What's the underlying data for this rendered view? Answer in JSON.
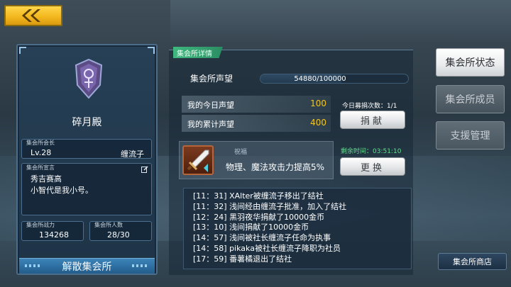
{
  "nav": {
    "back_icon": "double-chevron-left-icon"
  },
  "guild": {
    "name": "碎月殿",
    "leader_label": "集会所会长",
    "level": "Lv.28",
    "leader_name": "缠流子",
    "motto_label": "集会所宣言",
    "motto_lines": [
      "秀吉赛高",
      "小智代是我小号。"
    ],
    "power_label": "集会所战力",
    "power_value": "134268",
    "members_label": "集会所人数",
    "members_value": "28/30",
    "dissolve_label": "解散集会所"
  },
  "details": {
    "tab_label": "集会所详情",
    "reputation_label": "集会所声望",
    "reputation_value": "54880/100000",
    "reputation_progress": 0.5488,
    "today_label": "我的今日声望",
    "today_value": "100",
    "total_label": "我的累计声望",
    "total_value": "400",
    "donate_count": "今日募捐次数：1/1",
    "donate_button": "捐献",
    "blessing_title": "祝福",
    "blessing_text": "物理、魔法攻击力提高5%",
    "remaining_time": "剩余时间：03:51:10",
    "change_button": "更换"
  },
  "log": [
    "[11：31] XAlter被缠流子移出了结社",
    "[11：32] 浅间经由缠流子批准，加入了结社",
    "[12：24] 黑羽夜华捐献了10000金币",
    "[13：10] 浅间捐献了10000金币",
    "[14：57] 浅间被社长缠流子任命为执事",
    "[14：58] pikaka被社长缠流子降职为社员",
    "[17：59] 番薯橘退出了结社"
  ],
  "menu": {
    "status": "集会所状态",
    "members": "集会所成员",
    "support": "支援管理",
    "shop": "集会所商店"
  },
  "colors": {
    "accent_gold": "#f5c518",
    "accent_green": "#3fb87f",
    "time_green": "#5fe08c"
  }
}
